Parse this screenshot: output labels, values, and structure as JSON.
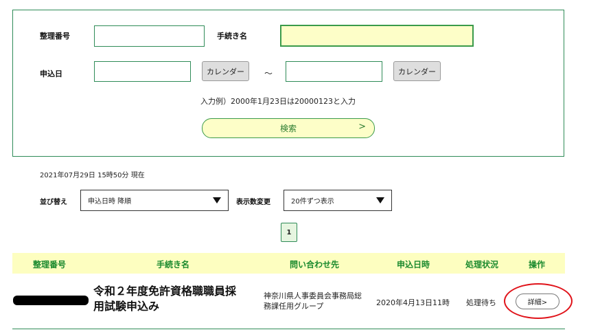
{
  "search": {
    "ref_no_label": "整理番号",
    "procedure_label": "手続き名",
    "apply_date_label": "申込日",
    "calendar_label": "カレンダー",
    "tilde": "～",
    "date_hint": "入力例）2000年1月23日は20000123と入力",
    "search_label": "検索",
    "search_arrow": ">"
  },
  "timestamp": "2021年07月29日 15時50分 現在",
  "sort": {
    "label": "並び替え",
    "selected": "申込日時 降順",
    "count_label": "表示数変更",
    "count_selected": "20件ずつ表示"
  },
  "pagination": {
    "current": "1"
  },
  "table": {
    "headers": [
      "整理番号",
      "手続き名",
      "問い合わせ先",
      "申込日時",
      "処理状況",
      "操作"
    ],
    "rows": [
      {
        "title_line1": "令和２年度免許資格職職員採",
        "title_line2": "用試験申込み",
        "contact_line1": "神奈川県人事委員会事務局総",
        "contact_line2": "務課任用グループ",
        "date": "2020年4月13日11時",
        "status": "処理待ち",
        "action": "詳細>"
      }
    ]
  },
  "colors": {
    "accent": "#2e8b57",
    "header_bg": "#fdfec0",
    "highlight": "#e0131a"
  }
}
